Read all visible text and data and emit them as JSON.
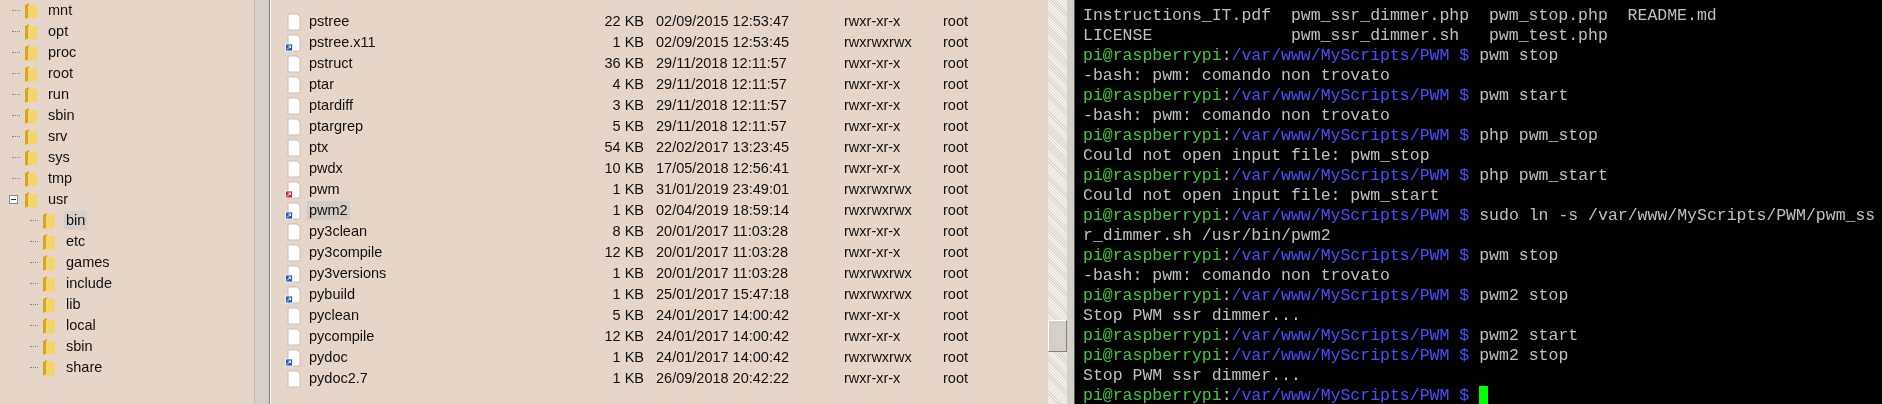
{
  "tree": [
    {
      "label": "mnt",
      "selected": false
    },
    {
      "label": "opt",
      "selected": false
    },
    {
      "label": "proc",
      "selected": false
    },
    {
      "label": "root",
      "selected": false
    },
    {
      "label": "run",
      "selected": false
    },
    {
      "label": "sbin",
      "selected": false
    },
    {
      "label": "srv",
      "selected": false
    },
    {
      "label": "sys",
      "selected": false
    },
    {
      "label": "tmp",
      "selected": false
    },
    {
      "label": "usr",
      "selected": false,
      "expanded": true,
      "children": [
        {
          "label": "bin",
          "selected": true
        },
        {
          "label": "etc",
          "selected": false
        },
        {
          "label": "games",
          "selected": false
        },
        {
          "label": "include",
          "selected": false
        },
        {
          "label": "lib",
          "selected": false
        },
        {
          "label": "local",
          "selected": false
        },
        {
          "label": "sbin",
          "selected": false
        },
        {
          "label": "share",
          "selected": false
        }
      ]
    }
  ],
  "files": [
    {
      "name": "pstree",
      "kind": "file",
      "size": "22 KB",
      "modified": "02/09/2015 12:53:47",
      "permissions": "rwxr-xr-x",
      "owner": "root",
      "selected": false
    },
    {
      "name": "pstree.x11",
      "kind": "link",
      "size": "1 KB",
      "modified": "02/09/2015 12:53:45",
      "permissions": "rwxrwxrwx",
      "owner": "root",
      "selected": false
    },
    {
      "name": "pstruct",
      "kind": "file",
      "size": "36 KB",
      "modified": "29/11/2018 12:11:57",
      "permissions": "rwxr-xr-x",
      "owner": "root",
      "selected": false
    },
    {
      "name": "ptar",
      "kind": "file",
      "size": "4 KB",
      "modified": "29/11/2018 12:11:57",
      "permissions": "rwxr-xr-x",
      "owner": "root",
      "selected": false
    },
    {
      "name": "ptardiff",
      "kind": "file",
      "size": "3 KB",
      "modified": "29/11/2018 12:11:57",
      "permissions": "rwxr-xr-x",
      "owner": "root",
      "selected": false
    },
    {
      "name": "ptargrep",
      "kind": "file",
      "size": "5 KB",
      "modified": "29/11/2018 12:11:57",
      "permissions": "rwxr-xr-x",
      "owner": "root",
      "selected": false
    },
    {
      "name": "ptx",
      "kind": "file",
      "size": "54 KB",
      "modified": "22/02/2017 13:23:45",
      "permissions": "rwxr-xr-x",
      "owner": "root",
      "selected": false
    },
    {
      "name": "pwdx",
      "kind": "file",
      "size": "10 KB",
      "modified": "17/05/2018 12:56:41",
      "permissions": "rwxr-xr-x",
      "owner": "root",
      "selected": false
    },
    {
      "name": "pwm",
      "kind": "broken-link",
      "size": "1 KB",
      "modified": "31/01/2019 23:49:01",
      "permissions": "rwxrwxrwx",
      "owner": "root",
      "selected": false
    },
    {
      "name": "pwm2",
      "kind": "link",
      "size": "1 KB",
      "modified": "02/04/2019 18:59:14",
      "permissions": "rwxrwxrwx",
      "owner": "root",
      "selected": true
    },
    {
      "name": "py3clean",
      "kind": "file",
      "size": "8 KB",
      "modified": "20/01/2017 11:03:28",
      "permissions": "rwxr-xr-x",
      "owner": "root",
      "selected": false
    },
    {
      "name": "py3compile",
      "kind": "file",
      "size": "12 KB",
      "modified": "20/01/2017 11:03:28",
      "permissions": "rwxr-xr-x",
      "owner": "root",
      "selected": false
    },
    {
      "name": "py3versions",
      "kind": "link",
      "size": "1 KB",
      "modified": "20/01/2017 11:03:28",
      "permissions": "rwxrwxrwx",
      "owner": "root",
      "selected": false
    },
    {
      "name": "pybuild",
      "kind": "link",
      "size": "1 KB",
      "modified": "25/01/2017 15:47:18",
      "permissions": "rwxrwxrwx",
      "owner": "root",
      "selected": false
    },
    {
      "name": "pyclean",
      "kind": "file",
      "size": "5 KB",
      "modified": "24/01/2017 14:00:42",
      "permissions": "rwxr-xr-x",
      "owner": "root",
      "selected": false
    },
    {
      "name": "pycompile",
      "kind": "file",
      "size": "12 KB",
      "modified": "24/01/2017 14:00:42",
      "permissions": "rwxr-xr-x",
      "owner": "root",
      "selected": false
    },
    {
      "name": "pydoc",
      "kind": "link",
      "size": "1 KB",
      "modified": "24/01/2017 14:00:42",
      "permissions": "rwxrwxrwx",
      "owner": "root",
      "selected": false
    },
    {
      "name": "pydoc2.7",
      "kind": "file",
      "size": "1 KB",
      "modified": "26/09/2018 20:42:22",
      "permissions": "rwxr-xr-x",
      "owner": "root",
      "selected": false
    }
  ],
  "terminal": [
    {
      "kind": "output",
      "text": "Instructions_IT.pdf  pwm_ssr_dimmer.php  pwm_stop.php  README.md"
    },
    {
      "kind": "output",
      "text": "LICENSE              pwm_ssr_dimmer.sh   pwm_test.php"
    },
    {
      "kind": "prompt",
      "user": "pi@raspberrypi",
      "separator": ":",
      "path": "/var/www/MyScripts/PWM $",
      "command": "pwm stop"
    },
    {
      "kind": "output",
      "text": "-bash: pwm: comando non trovato"
    },
    {
      "kind": "prompt",
      "user": "pi@raspberrypi",
      "separator": ":",
      "path": "/var/www/MyScripts/PWM $",
      "command": "pwm start"
    },
    {
      "kind": "output",
      "text": "-bash: pwm: comando non trovato"
    },
    {
      "kind": "prompt",
      "user": "pi@raspberrypi",
      "separator": ":",
      "path": "/var/www/MyScripts/PWM $",
      "command": "php pwm_stop"
    },
    {
      "kind": "output",
      "text": "Could not open input file: pwm_stop"
    },
    {
      "kind": "prompt",
      "user": "pi@raspberrypi",
      "separator": ":",
      "path": "/var/www/MyScripts/PWM $",
      "command": "php pwm_start"
    },
    {
      "kind": "output",
      "text": "Could not open input file: pwm_start"
    },
    {
      "kind": "prompt",
      "user": "pi@raspberrypi",
      "separator": ":",
      "path": "/var/www/MyScripts/PWM $",
      "command": "sudo ln -s /var/www/MyScripts/PWM/pwm_ss"
    },
    {
      "kind": "output",
      "text": "r_dimmer.sh /usr/bin/pwm2"
    },
    {
      "kind": "prompt",
      "user": "pi@raspberrypi",
      "separator": ":",
      "path": "/var/www/MyScripts/PWM $",
      "command": "pwm stop"
    },
    {
      "kind": "output",
      "text": "-bash: pwm: comando non trovato"
    },
    {
      "kind": "prompt",
      "user": "pi@raspberrypi",
      "separator": ":",
      "path": "/var/www/MyScripts/PWM $",
      "command": "pwm2 stop"
    },
    {
      "kind": "output",
      "text": "Stop PWM ssr dimmer..."
    },
    {
      "kind": "prompt",
      "user": "pi@raspberrypi",
      "separator": ":",
      "path": "/var/www/MyScripts/PWM $",
      "command": "pwm2 start"
    },
    {
      "kind": "prompt",
      "user": "pi@raspberrypi",
      "separator": ":",
      "path": "/var/www/MyScripts/PWM $",
      "command": "pwm2 stop"
    },
    {
      "kind": "output",
      "text": "Stop PWM ssr dimmer..."
    },
    {
      "kind": "prompt",
      "user": "pi@raspberrypi",
      "separator": ":",
      "path": "/var/www/MyScripts/PWM $",
      "cursor": true
    }
  ]
}
